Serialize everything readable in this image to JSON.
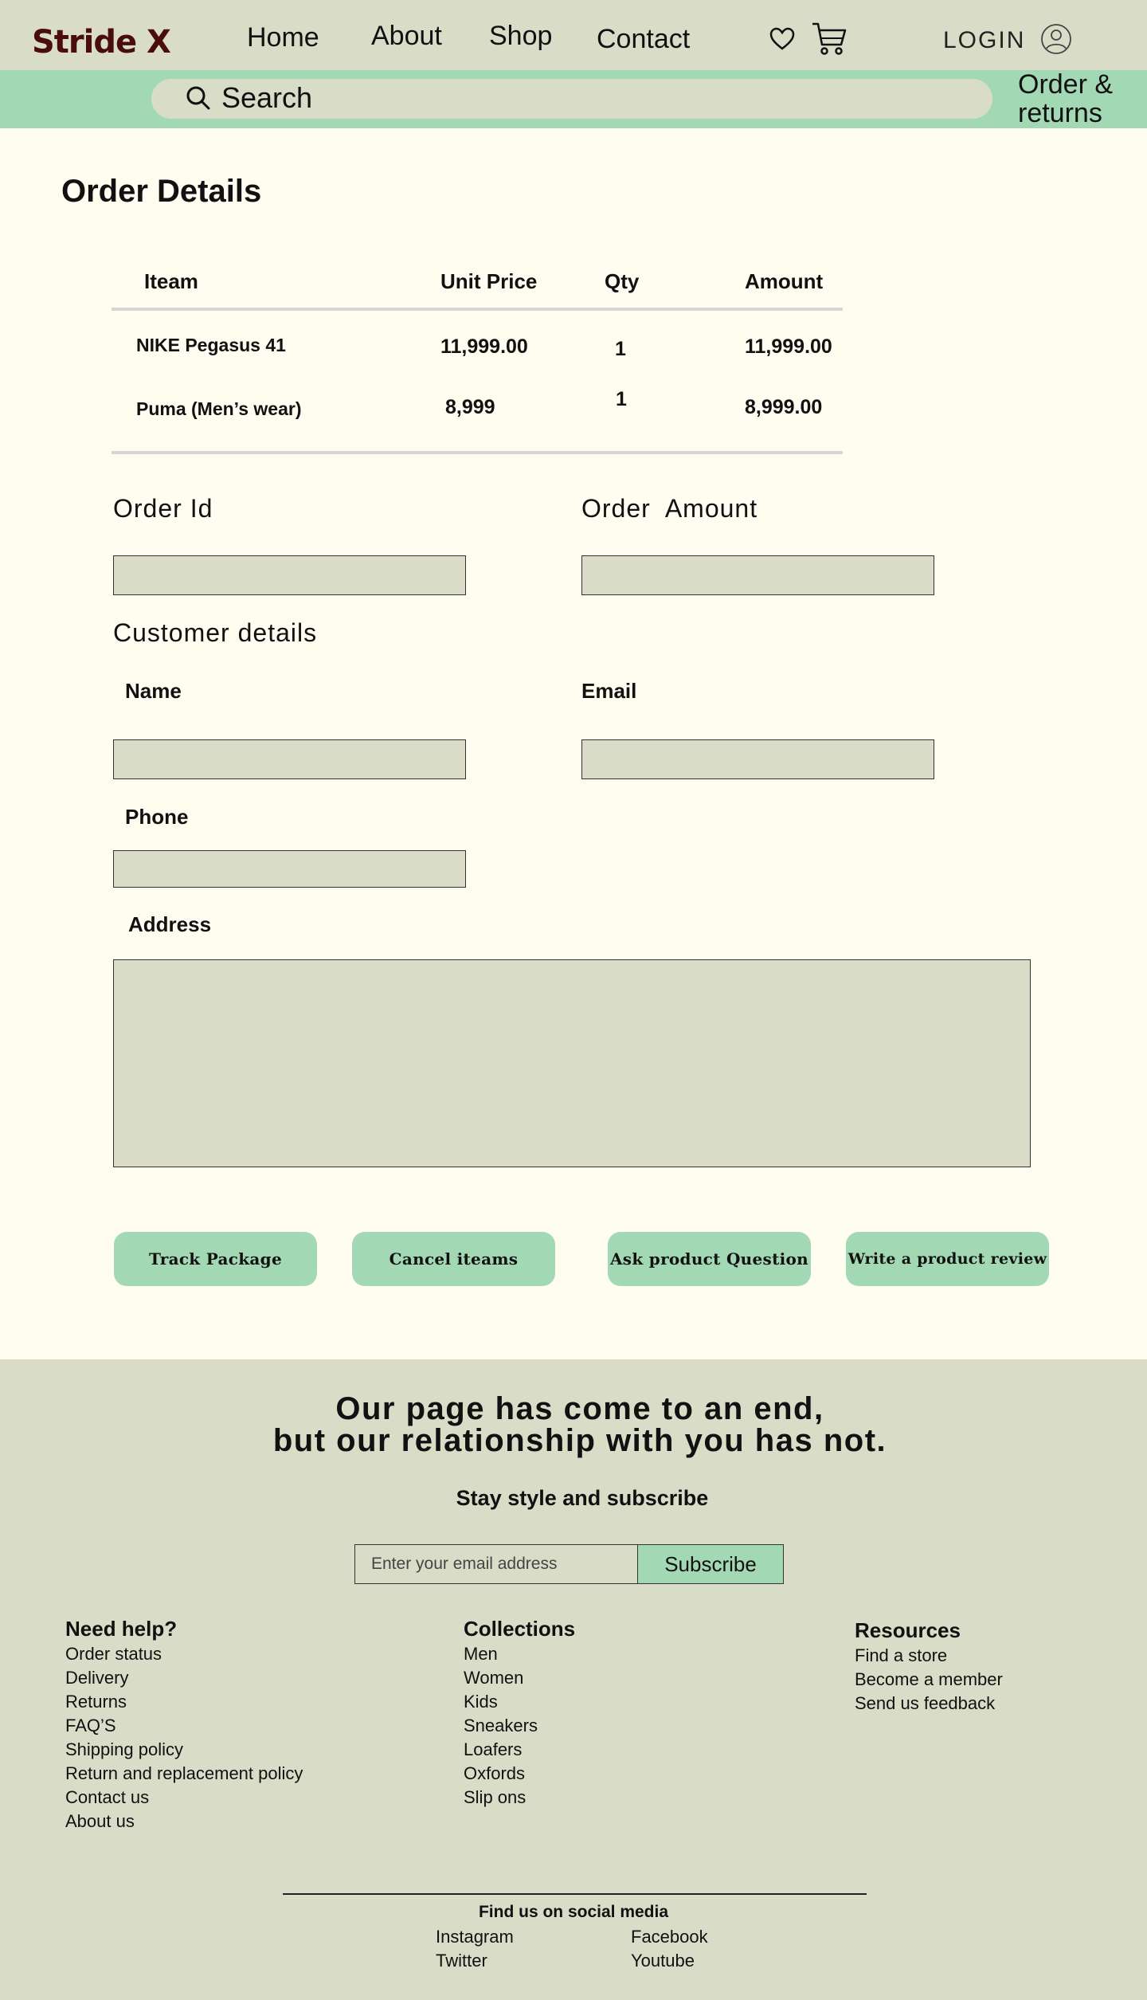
{
  "header": {
    "logo": "Stride X",
    "nav": [
      "Home",
      "About",
      "Shop",
      "Contact"
    ],
    "login": "LOGIN",
    "search_placeholder": "Search",
    "orders_line1": "Order &",
    "orders_line2": "returns"
  },
  "order": {
    "title": "Order Details",
    "columns": [
      "Iteam",
      "Unit Price",
      "Qty",
      "Amount"
    ],
    "rows": [
      {
        "item": "NIKE Pegasus 41",
        "unit_price": "11,999.00",
        "qty": "1",
        "amount": "11,999.00"
      },
      {
        "item": "Puma (Men’s wear)",
        "unit_price": "8,999",
        "qty": "1",
        "amount": "8,999.00"
      }
    ],
    "order_id_label": "Order Id",
    "order_amount_label": "Order  Amount",
    "customer_heading": "Customer details",
    "name_label": "Name",
    "email_label": "Email",
    "phone_label": "Phone",
    "address_label": "Address"
  },
  "actions": {
    "track": "Track Package",
    "cancel": "Cancel iteams",
    "ask": "Ask product Question",
    "review": "Write a product review"
  },
  "footer": {
    "slogan_line1": "Our page has come to an end,",
    "slogan_line2": "but our relationship with you has not.",
    "stay": "Stay style and subscribe",
    "email_placeholder": "Enter your email address",
    "subscribe": "Subscribe",
    "help": {
      "heading": "Need help?",
      "items": [
        "Order status",
        "Delivery",
        "Returns",
        "FAQ’S",
        "Shipping policy",
        "Return and replacement policy",
        "Contact us",
        "About us"
      ]
    },
    "collections": {
      "heading": "Collections",
      "items": [
        "Men",
        "Women",
        "Kids",
        "Sneakers",
        "Loafers",
        "Oxfords",
        "Slip ons"
      ]
    },
    "resources": {
      "heading": "Resources",
      "items": [
        "Find a store",
        "Become a member",
        "Send us feedback"
      ]
    },
    "social_heading": "Find us on social media",
    "social": [
      "Instagram",
      "Facebook",
      "Twitter",
      "Youtube"
    ]
  },
  "colors": {
    "header_bg": "#d9ddc8",
    "accent_green": "#a2d9b4",
    "page_bg": "#fefdf0",
    "logo": "#4a0d0a"
  },
  "icons": [
    "heart-icon",
    "cart-icon",
    "user-icon",
    "search-icon"
  ]
}
